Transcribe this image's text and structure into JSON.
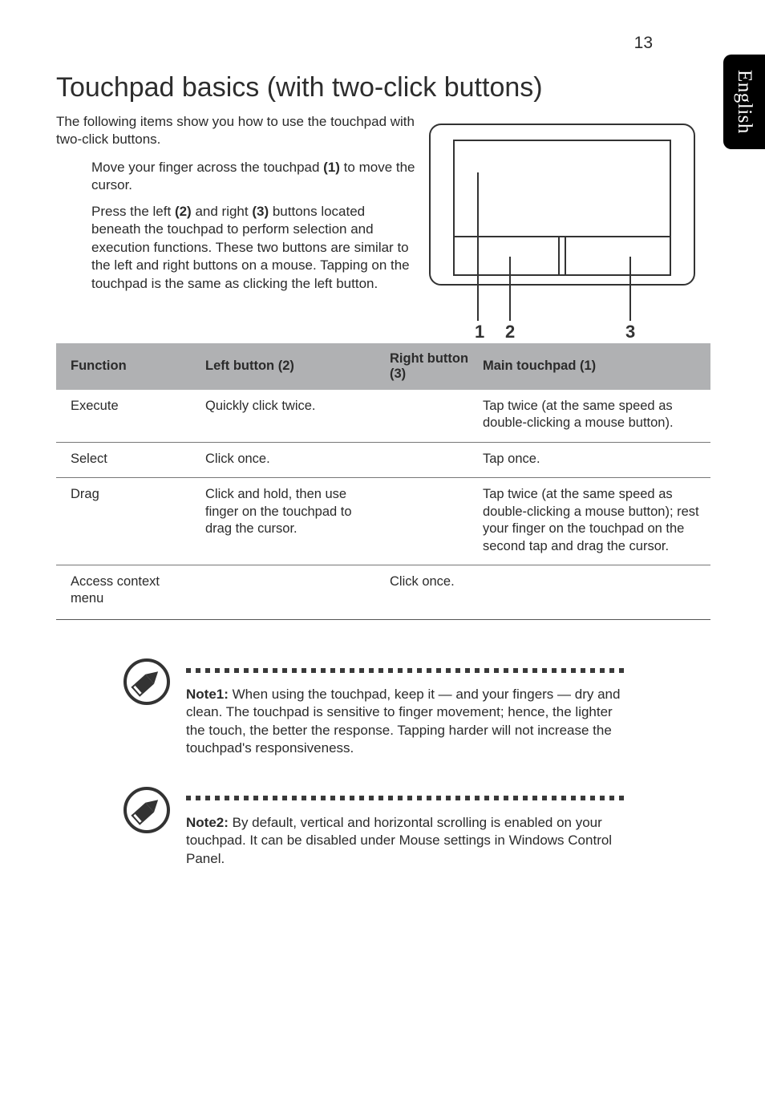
{
  "page_number": "13",
  "side_tab": "English",
  "heading": "Touchpad basics (with two-click buttons)",
  "lead": "The following items show you how to use the touchpad with two-click buttons.",
  "bullets": [
    {
      "pre": "Move your finger across the touchpad ",
      "bold": "(1)",
      "post": " to move the cursor."
    },
    {
      "pre": "Press the left ",
      "bold": "(2)",
      "mid": " and right ",
      "bold2": "(3)",
      "post": " buttons located beneath the touchpad to perform selection and execution functions. These two buttons are similar to the left and right buttons on a mouse. Tapping on the touchpad is the same as clicking the left button."
    }
  ],
  "diagram": {
    "label1": "1",
    "label2": "2",
    "label3": "3"
  },
  "table": {
    "header": {
      "c1": "Function",
      "c2": "Left button (2)",
      "c3": "Right button (3)",
      "c4": "Main touchpad (1)"
    },
    "rows": [
      {
        "c1": "Execute",
        "c2": "Quickly click twice.",
        "c3": "",
        "c4": "Tap twice (at the same speed as double-clicking a mouse button)."
      },
      {
        "c1": "Select",
        "c2": "Click once.",
        "c3": "",
        "c4": "Tap once."
      },
      {
        "c1": "Drag",
        "c2": "Click and hold, then use finger on the touchpad to drag the cursor.",
        "c3": "",
        "c4": "Tap twice (at the same speed as double-clicking a mouse button); rest your finger on the touchpad on the second tap and drag the cursor."
      },
      {
        "c1": "Access context menu",
        "c2": "",
        "c3": "Click once.",
        "c4": ""
      }
    ]
  },
  "notes": [
    {
      "label": "Note1: ",
      "text": "When using the touchpad, keep it — and your fingers — dry and clean. The touchpad is sensitive to finger movement; hence, the lighter the touch, the better the response. Tapping harder will not increase the touchpad's responsiveness."
    },
    {
      "label": "Note2: ",
      "text": "By default, vertical and horizontal scrolling is enabled on your touchpad. It can be disabled under Mouse settings in Windows Control Panel."
    }
  ]
}
